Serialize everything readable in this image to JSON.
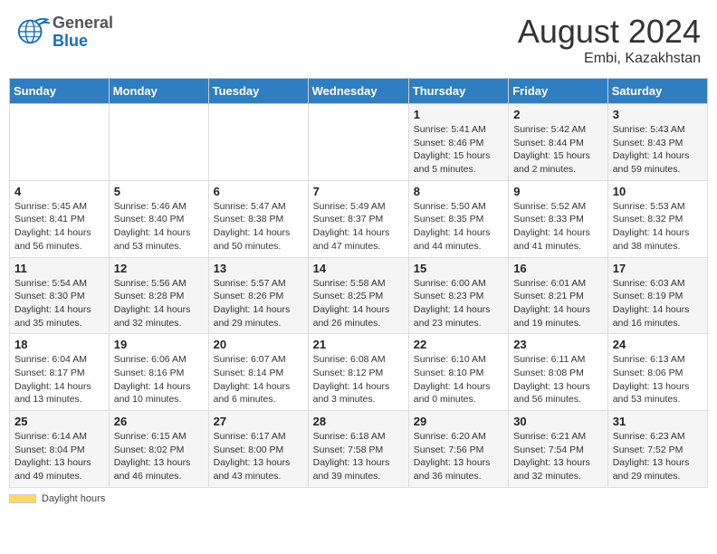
{
  "header": {
    "logo_general": "General",
    "logo_blue": "Blue",
    "title": "August 2024",
    "location": "Embi, Kazakhstan"
  },
  "weekdays": [
    "Sunday",
    "Monday",
    "Tuesday",
    "Wednesday",
    "Thursday",
    "Friday",
    "Saturday"
  ],
  "footer": {
    "daylight_label": "Daylight hours"
  },
  "weeks": [
    [
      {
        "day": "",
        "detail": ""
      },
      {
        "day": "",
        "detail": ""
      },
      {
        "day": "",
        "detail": ""
      },
      {
        "day": "",
        "detail": ""
      },
      {
        "day": "1",
        "detail": "Sunrise: 5:41 AM\nSunset: 8:46 PM\nDaylight: 15 hours\nand 5 minutes."
      },
      {
        "day": "2",
        "detail": "Sunrise: 5:42 AM\nSunset: 8:44 PM\nDaylight: 15 hours\nand 2 minutes."
      },
      {
        "day": "3",
        "detail": "Sunrise: 5:43 AM\nSunset: 8:43 PM\nDaylight: 14 hours\nand 59 minutes."
      }
    ],
    [
      {
        "day": "4",
        "detail": "Sunrise: 5:45 AM\nSunset: 8:41 PM\nDaylight: 14 hours\nand 56 minutes."
      },
      {
        "day": "5",
        "detail": "Sunrise: 5:46 AM\nSunset: 8:40 PM\nDaylight: 14 hours\nand 53 minutes."
      },
      {
        "day": "6",
        "detail": "Sunrise: 5:47 AM\nSunset: 8:38 PM\nDaylight: 14 hours\nand 50 minutes."
      },
      {
        "day": "7",
        "detail": "Sunrise: 5:49 AM\nSunset: 8:37 PM\nDaylight: 14 hours\nand 47 minutes."
      },
      {
        "day": "8",
        "detail": "Sunrise: 5:50 AM\nSunset: 8:35 PM\nDaylight: 14 hours\nand 44 minutes."
      },
      {
        "day": "9",
        "detail": "Sunrise: 5:52 AM\nSunset: 8:33 PM\nDaylight: 14 hours\nand 41 minutes."
      },
      {
        "day": "10",
        "detail": "Sunrise: 5:53 AM\nSunset: 8:32 PM\nDaylight: 14 hours\nand 38 minutes."
      }
    ],
    [
      {
        "day": "11",
        "detail": "Sunrise: 5:54 AM\nSunset: 8:30 PM\nDaylight: 14 hours\nand 35 minutes."
      },
      {
        "day": "12",
        "detail": "Sunrise: 5:56 AM\nSunset: 8:28 PM\nDaylight: 14 hours\nand 32 minutes."
      },
      {
        "day": "13",
        "detail": "Sunrise: 5:57 AM\nSunset: 8:26 PM\nDaylight: 14 hours\nand 29 minutes."
      },
      {
        "day": "14",
        "detail": "Sunrise: 5:58 AM\nSunset: 8:25 PM\nDaylight: 14 hours\nand 26 minutes."
      },
      {
        "day": "15",
        "detail": "Sunrise: 6:00 AM\nSunset: 8:23 PM\nDaylight: 14 hours\nand 23 minutes."
      },
      {
        "day": "16",
        "detail": "Sunrise: 6:01 AM\nSunset: 8:21 PM\nDaylight: 14 hours\nand 19 minutes."
      },
      {
        "day": "17",
        "detail": "Sunrise: 6:03 AM\nSunset: 8:19 PM\nDaylight: 14 hours\nand 16 minutes."
      }
    ],
    [
      {
        "day": "18",
        "detail": "Sunrise: 6:04 AM\nSunset: 8:17 PM\nDaylight: 14 hours\nand 13 minutes."
      },
      {
        "day": "19",
        "detail": "Sunrise: 6:06 AM\nSunset: 8:16 PM\nDaylight: 14 hours\nand 10 minutes."
      },
      {
        "day": "20",
        "detail": "Sunrise: 6:07 AM\nSunset: 8:14 PM\nDaylight: 14 hours\nand 6 minutes."
      },
      {
        "day": "21",
        "detail": "Sunrise: 6:08 AM\nSunset: 8:12 PM\nDaylight: 14 hours\nand 3 minutes."
      },
      {
        "day": "22",
        "detail": "Sunrise: 6:10 AM\nSunset: 8:10 PM\nDaylight: 14 hours\nand 0 minutes."
      },
      {
        "day": "23",
        "detail": "Sunrise: 6:11 AM\nSunset: 8:08 PM\nDaylight: 13 hours\nand 56 minutes."
      },
      {
        "day": "24",
        "detail": "Sunrise: 6:13 AM\nSunset: 8:06 PM\nDaylight: 13 hours\nand 53 minutes."
      }
    ],
    [
      {
        "day": "25",
        "detail": "Sunrise: 6:14 AM\nSunset: 8:04 PM\nDaylight: 13 hours\nand 49 minutes."
      },
      {
        "day": "26",
        "detail": "Sunrise: 6:15 AM\nSunset: 8:02 PM\nDaylight: 13 hours\nand 46 minutes."
      },
      {
        "day": "27",
        "detail": "Sunrise: 6:17 AM\nSunset: 8:00 PM\nDaylight: 13 hours\nand 43 minutes."
      },
      {
        "day": "28",
        "detail": "Sunrise: 6:18 AM\nSunset: 7:58 PM\nDaylight: 13 hours\nand 39 minutes."
      },
      {
        "day": "29",
        "detail": "Sunrise: 6:20 AM\nSunset: 7:56 PM\nDaylight: 13 hours\nand 36 minutes."
      },
      {
        "day": "30",
        "detail": "Sunrise: 6:21 AM\nSunset: 7:54 PM\nDaylight: 13 hours\nand 32 minutes."
      },
      {
        "day": "31",
        "detail": "Sunrise: 6:23 AM\nSunset: 7:52 PM\nDaylight: 13 hours\nand 29 minutes."
      }
    ]
  ]
}
